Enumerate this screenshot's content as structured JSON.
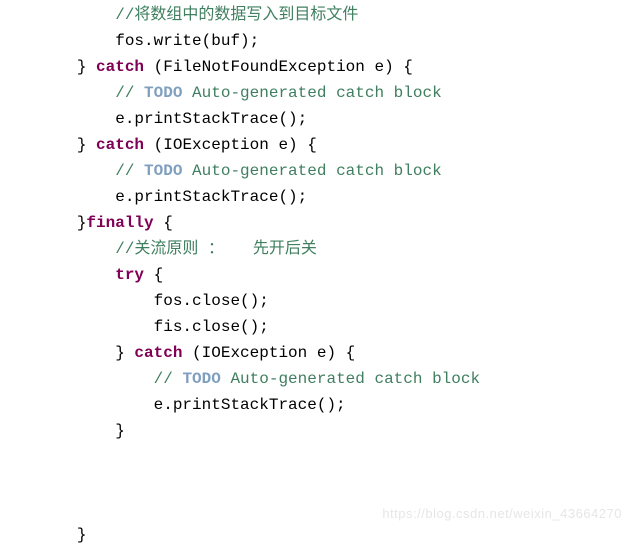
{
  "code": {
    "l0_indent": "            ",
    "l0_c": "//将数组中的数据写入到目标文件",
    "l1_indent": "            ",
    "l1_a": "fos.write(buf);",
    "l2_indent": "        ",
    "l2_a": "} ",
    "l2_kw": "catch",
    "l2_b": " (FileNotFoundException e) {",
    "l3_indent": "            ",
    "l3_a": "// ",
    "l3_todo": "TODO",
    "l3_b": " Auto-generated catch block",
    "l4_indent": "            ",
    "l4_a": "e.printStackTrace();",
    "l5_indent": "        ",
    "l5_a": "} ",
    "l5_kw": "catch",
    "l5_b": " (IOException e) {",
    "l6_indent": "            ",
    "l6_a": "// ",
    "l6_todo": "TODO",
    "l6_b": " Auto-generated catch block",
    "l7_indent": "            ",
    "l7_a": "e.printStackTrace();",
    "l8_indent": "        ",
    "l8_a": "}",
    "l8_kw": "finally",
    "l8_b": " {",
    "l9_indent": "            ",
    "l9_c": "//关流原则 ：   先开后关",
    "l10_indent": "            ",
    "l10_kw": "try",
    "l10_a": " {",
    "l11_indent": "                ",
    "l11_a": "fos.close();",
    "l12_indent": "                ",
    "l12_a": "fis.close();",
    "l13_indent": "            ",
    "l13_a": "} ",
    "l13_kw": "catch",
    "l13_b": " (IOException e) {",
    "l14_indent": "                ",
    "l14_a": "// ",
    "l14_todo": "TODO",
    "l14_b": " Auto-generated catch block",
    "l15_indent": "                ",
    "l15_a": "e.printStackTrace();",
    "l16_indent": "            ",
    "l16_a": "}",
    "l20_indent": "        ",
    "l20_a": "}"
  },
  "watermark": "https://blog.csdn.net/weixin_43664270"
}
